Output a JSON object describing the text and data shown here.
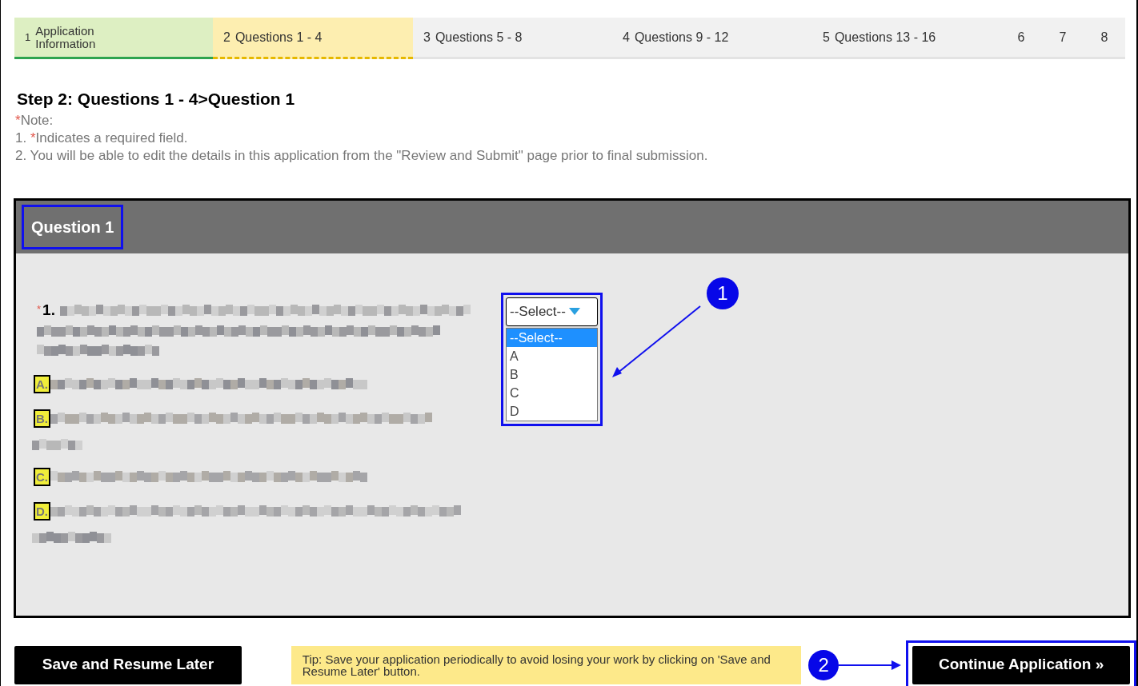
{
  "steps": [
    {
      "number": "1",
      "label": "Application Information",
      "completed": true,
      "selected": false
    },
    {
      "number": "2",
      "label": "Questions 1 - 4",
      "completed": false,
      "selected": true
    },
    {
      "number": "3",
      "label": "Questions 5 - 8",
      "completed": false,
      "selected": false
    },
    {
      "number": "4",
      "label": "Questions 9 - 12",
      "completed": false,
      "selected": false
    },
    {
      "number": "5",
      "label": "Questions 13 - 16",
      "completed": false,
      "selected": false
    },
    {
      "number": "6",
      "completed": false,
      "selected": false
    },
    {
      "number": "7",
      "completed": false,
      "selected": false
    },
    {
      "number": "8",
      "completed": false,
      "selected": false
    }
  ],
  "heading": {
    "step": "Step 2:",
    "section": "Questions 1 - 4",
    "separator": ">",
    "page": "Question 1"
  },
  "note": {
    "mark": "*",
    "title": "Note:",
    "lines": [
      {
        "prefix": "1.",
        "mark": "*",
        "text": "Indicates a required field."
      },
      {
        "prefix": "2.",
        "text": "You will be able to edit the details in this application from the \"Review and Submit\" page prior to final submission."
      }
    ]
  },
  "panel": {
    "title": "Question 1",
    "highlighted": true
  },
  "question": {
    "mark": "*",
    "number": "1.",
    "options": [
      {
        "letter": "A."
      },
      {
        "letter": "B."
      },
      {
        "letter": "C."
      },
      {
        "letter": "D."
      }
    ]
  },
  "dropdown": {
    "value": "--Select--",
    "expanded": true,
    "highlighted": true,
    "items": [
      {
        "label": "--Select--",
        "selected": true
      },
      {
        "label": "A",
        "selected": false
      },
      {
        "label": "B",
        "selected": false
      },
      {
        "label": "C",
        "selected": false
      },
      {
        "label": "D",
        "selected": false
      }
    ]
  },
  "callouts": [
    "1",
    "2"
  ],
  "footer": {
    "save_button": "Save and Resume Later",
    "tip": "Tip: Save your application periodically to avoid losing your work by clicking on 'Save and Resume Later' button.",
    "continue_button": "Continue Application »",
    "continue_highlighted": true
  }
}
